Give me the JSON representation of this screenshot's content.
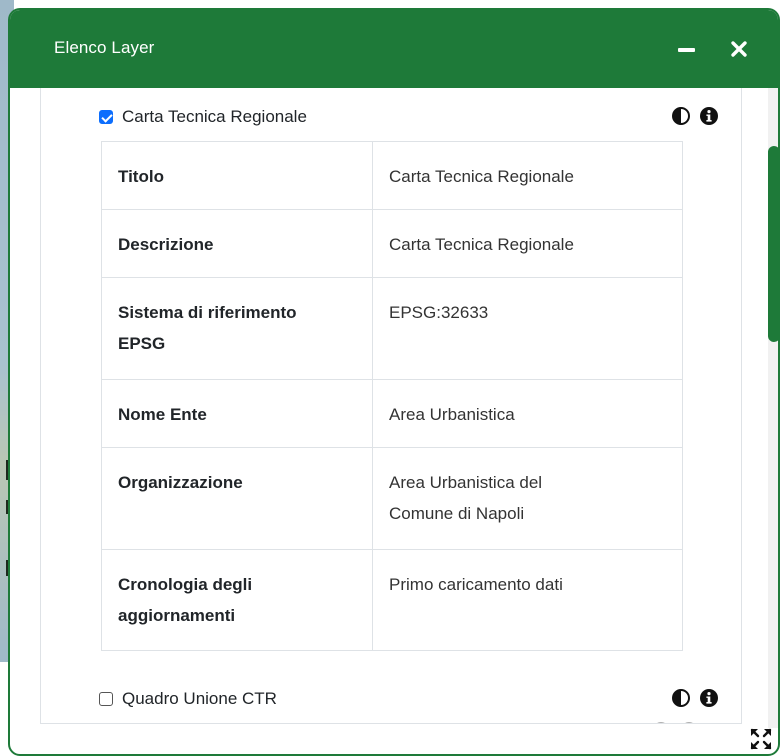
{
  "window": {
    "title": "Elenco Layer"
  },
  "layers": [
    {
      "label": "Carta Tecnica Regionale",
      "checked": true
    },
    {
      "label": "Quadro Unione CTR",
      "checked": false
    }
  ],
  "info_table": [
    {
      "key": "Titolo",
      "value": "Carta Tecnica Regionale"
    },
    {
      "key": "Descrizione",
      "value": "Carta Tecnica Regionale"
    },
    {
      "key_lines": [
        "Sistema di riferimento",
        "EPSG"
      ],
      "value": "EPSG:32633"
    },
    {
      "key": "Nome Ente",
      "value": "Area Urbanistica"
    },
    {
      "key": "Organizzazione",
      "value_lines": [
        "Area Urbanistica del",
        "Comune di Napoli"
      ]
    },
    {
      "key_lines": [
        "Cronologia degli",
        "aggiornamenti"
      ],
      "value": "Primo caricamento dati"
    }
  ],
  "icons": {
    "opacity": "contrast-icon",
    "info": "info-icon",
    "minimize": "minimize-icon",
    "close": "close-icon",
    "expand": "expand-icon"
  },
  "colors": {
    "header": "#1e7a39",
    "checkbox": "#0d6efd",
    "scroll_thumb": "#1e7a39"
  }
}
